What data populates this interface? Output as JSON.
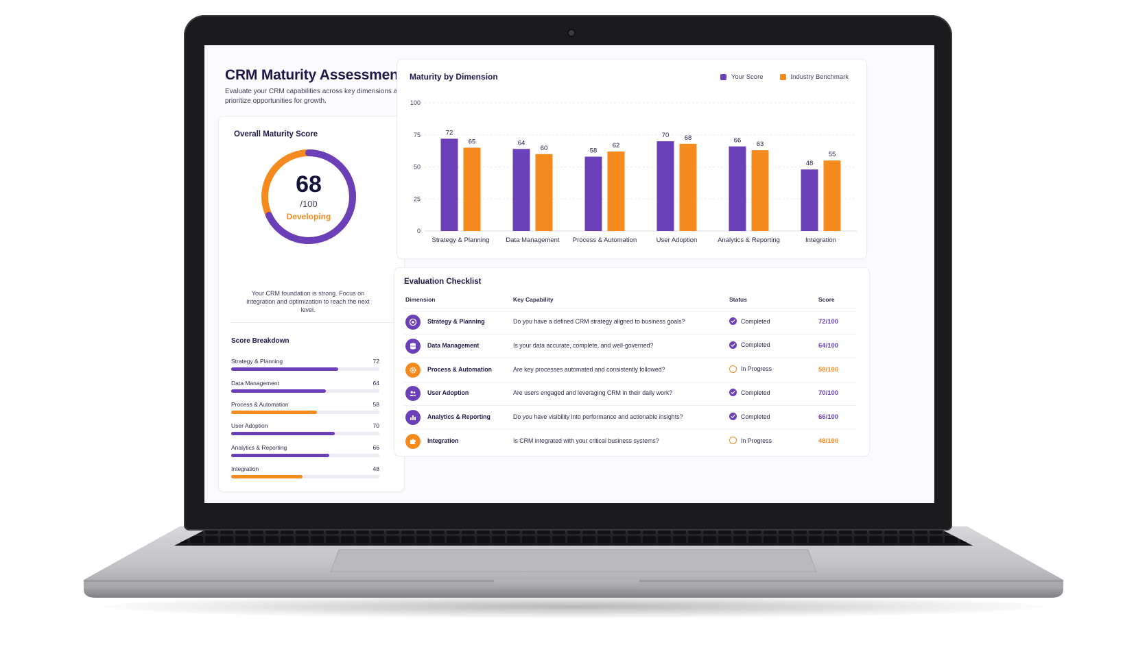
{
  "colors": {
    "purple": "#6b3fb8",
    "orange": "#f58a1f",
    "track": "#ecebf3"
  },
  "page": {
    "title": "CRM Maturity Assessment",
    "subtitle": "Evaluate your CRM capabilities across key dimensions and prioritize opportunities for growth."
  },
  "overall": {
    "title": "Overall Maturity Score",
    "score": "68",
    "score_value": 68,
    "denominator": "/100",
    "level": "Developing",
    "description": "Your CRM foundation is strong. Focus on integration and optimization to reach the next level."
  },
  "breakdown": {
    "title": "Score Breakdown",
    "items": [
      {
        "label": "Strategy & Planning",
        "value": "72",
        "fraction": 0.72,
        "color": "purple"
      },
      {
        "label": "Data Management",
        "value": "64",
        "fraction": 0.64,
        "color": "purple"
      },
      {
        "label": "Process & Automation",
        "value": "58",
        "fraction": 0.58,
        "color": "orange"
      },
      {
        "label": "User Adoption",
        "value": "70",
        "fraction": 0.7,
        "color": "purple"
      },
      {
        "label": "Analytics & Reporting",
        "value": "66",
        "fraction": 0.66,
        "color": "purple"
      },
      {
        "label": "Integration",
        "value": "48",
        "fraction": 0.48,
        "color": "orange"
      }
    ]
  },
  "chart_data": {
    "type": "bar",
    "title": "Maturity by Dimension",
    "categories": [
      "Strategy & Planning",
      "Data Management",
      "Process & Automation",
      "User Adoption",
      "Analytics & Reporting",
      "Integration"
    ],
    "series": [
      {
        "name": "Your Score",
        "color": "#6b3fb8",
        "values": [
          72,
          64,
          58,
          70,
          66,
          48
        ]
      },
      {
        "name": "Industry Benchmark",
        "color": "#f58a1f",
        "values": [
          65,
          60,
          62,
          68,
          63,
          55
        ]
      }
    ],
    "yticks": [
      0,
      25,
      50,
      75,
      100
    ],
    "ylim": [
      0,
      100
    ],
    "grid": true,
    "legend_position": "top-right"
  },
  "checklist": {
    "title": "Evaluation Checklist",
    "headers": {
      "dimension": "Dimension",
      "capability": "Key Capability",
      "status": "Status",
      "score": "Score"
    },
    "rows": [
      {
        "dimension": "Strategy & Planning",
        "icon": "target-icon",
        "icon_color": "purple",
        "capability": "Do you have a defined CRM strategy aligned to business goals?",
        "status": "Completed",
        "score": "72/100",
        "score_color": "purple"
      },
      {
        "dimension": "Data Management",
        "icon": "database-icon",
        "icon_color": "purple",
        "capability": "Is your data accurate, complete, and well-governed?",
        "status": "Completed",
        "score": "64/100",
        "score_color": "purple"
      },
      {
        "dimension": "Process & Automation",
        "icon": "gear-icon",
        "icon_color": "orange",
        "capability": "Are key processes automated and consistently followed?",
        "status": "In Progress",
        "score": "58/100",
        "score_color": "orange"
      },
      {
        "dimension": "User Adoption",
        "icon": "users-icon",
        "icon_color": "purple",
        "capability": "Are users engaged and leveraging CRM in their daily work?",
        "status": "Completed",
        "score": "70/100",
        "score_color": "purple"
      },
      {
        "dimension": "Analytics & Reporting",
        "icon": "bar-chart-icon",
        "icon_color": "purple",
        "capability": "Do you have visibility into performance and actionable insights?",
        "status": "Completed",
        "score": "66/100",
        "score_color": "purple"
      },
      {
        "dimension": "Integration",
        "icon": "puzzle-icon",
        "icon_color": "orange",
        "capability": "Is CRM integrated with your critical business systems?",
        "status": "In Progress",
        "score": "48/100",
        "score_color": "orange"
      }
    ]
  }
}
